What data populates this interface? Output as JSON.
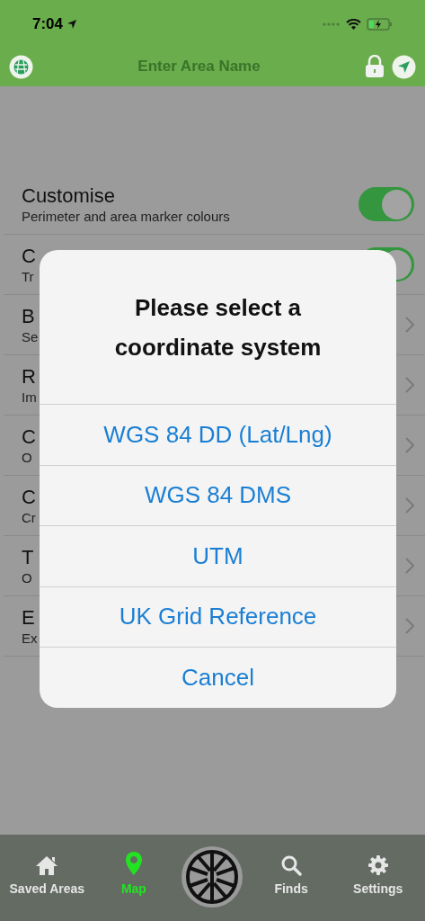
{
  "status_bar": {
    "time": "7:04"
  },
  "nav_bar": {
    "title_field": {
      "placeholder": "Enter Area Name"
    }
  },
  "settings_rows": [
    {
      "kind": "toggle",
      "title": "Customise",
      "subtitle": "Perimeter and area marker colours",
      "on": true
    },
    {
      "kind": "toggle",
      "title": "C",
      "subtitle": "Tr",
      "on": true
    },
    {
      "kind": "link",
      "title": "B",
      "subtitle": "Se"
    },
    {
      "kind": "link",
      "title": "R",
      "subtitle": "Im"
    },
    {
      "kind": "link",
      "title": "C",
      "subtitle": "O"
    },
    {
      "kind": "link",
      "title": "C",
      "subtitle": "Cr"
    },
    {
      "kind": "link",
      "title": "T",
      "subtitle": "O"
    },
    {
      "kind": "link",
      "title": "E",
      "subtitle": "Ex"
    }
  ],
  "dialog": {
    "title": "Please select a coordinate system",
    "options": [
      "WGS 84 DD (Lat/Lng)",
      "WGS 84 DMS",
      "UTM",
      "UK Grid Reference",
      "Cancel"
    ]
  },
  "tab_bar": [
    {
      "kind": "home",
      "label": "Saved Areas",
      "selected": false
    },
    {
      "kind": "pin",
      "label": "Map",
      "selected": true
    },
    {
      "kind": "logo"
    },
    {
      "kind": "search",
      "label": "Finds",
      "selected": false
    },
    {
      "kind": "gear",
      "label": "Settings",
      "selected": false
    }
  ]
}
